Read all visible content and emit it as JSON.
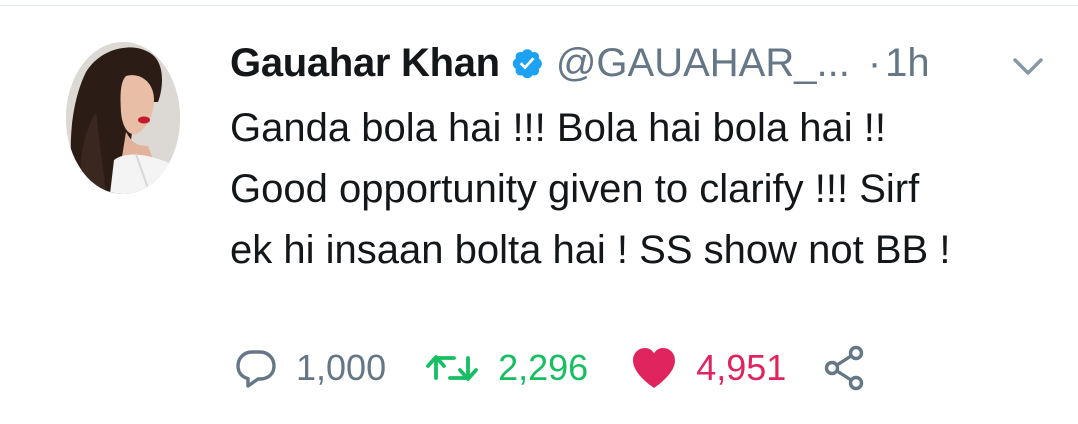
{
  "tweet": {
    "author_name": "Gauahar Khan",
    "handle": "@GAUAHAR_...",
    "separator": "·",
    "time": "1h",
    "verified": true,
    "text_lines": [
      "Ganda bola hai !!! Bola hai bola hai !!",
      "Good opportunity given to clarify !!! Sirf",
      "ek hi insaan bolta hai ! SS show not BB !"
    ],
    "stats": {
      "replies": "1,000",
      "retweets": "2,296",
      "likes": "4,951"
    }
  },
  "icons": {
    "verified": "verified-badge-icon",
    "caret": "chevron-down-icon",
    "reply": "reply-bubble-icon",
    "retweet": "retweet-icon",
    "like": "heart-icon",
    "share": "share-icon"
  },
  "colors": {
    "verified": "#1da1f2",
    "retweet": "#17bf63",
    "like": "#e0245e",
    "muted": "#657786",
    "text": "#14171a"
  }
}
